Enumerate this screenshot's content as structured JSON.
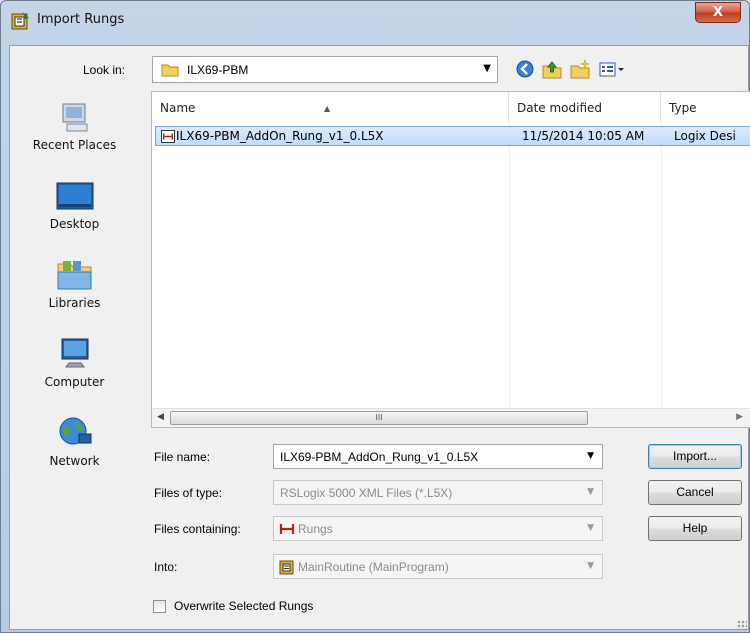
{
  "window": {
    "title": "Import Rungs",
    "close_label": "X"
  },
  "look_in": {
    "label": "Look in:",
    "value": "ILX69-PBM"
  },
  "places": [
    {
      "label": "Recent Places",
      "icon": "recent-places-icon"
    },
    {
      "label": "Desktop",
      "icon": "desktop-icon"
    },
    {
      "label": "Libraries",
      "icon": "libraries-icon"
    },
    {
      "label": "Computer",
      "icon": "computer-icon"
    },
    {
      "label": "Network",
      "icon": "network-icon"
    }
  ],
  "file_list": {
    "columns": [
      "Name",
      "Date modified",
      "Type"
    ],
    "rows": [
      {
        "name": "ILX69-PBM_AddOn_Rung_v1_0.L5X",
        "date": "11/5/2014 10:05 AM",
        "type": "Logix Desi"
      }
    ],
    "scroll_thumb": "III"
  },
  "fields": {
    "file_name": {
      "label": "File name:",
      "value": "ILX69-PBM_AddOn_Rung_v1_0.L5X"
    },
    "file_type": {
      "label": "Files of type:",
      "value": "RSLogix 5000 XML Files (*.L5X)"
    },
    "containing": {
      "label": "Files containing:",
      "value": "Rungs"
    },
    "into": {
      "label": "Into:",
      "value": "MainRoutine (MainProgram)"
    }
  },
  "buttons": {
    "import": "Import...",
    "cancel": "Cancel",
    "help": "Help"
  },
  "overwrite": {
    "label": "Overwrite Selected Rungs",
    "checked": false
  },
  "colors": {
    "selection": "#c2dcfd",
    "rung_red": "#b3261e",
    "close_red": "#c94a31"
  }
}
